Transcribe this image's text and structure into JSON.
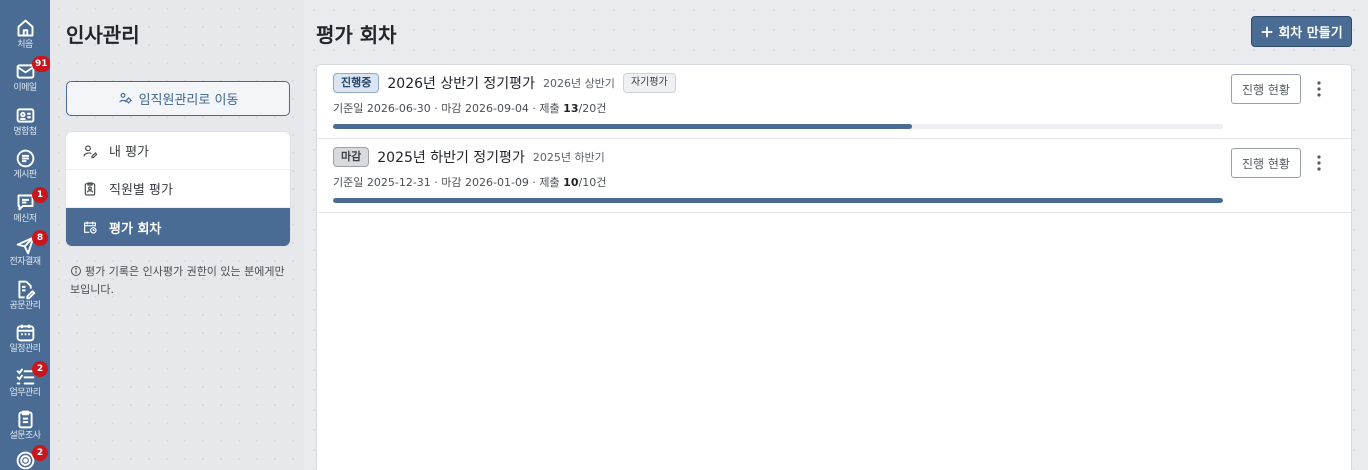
{
  "rail": {
    "items": [
      {
        "label": "처음",
        "icon": "home-icon",
        "badge": ""
      },
      {
        "label": "이메일",
        "icon": "mail-icon",
        "badge": "91"
      },
      {
        "label": "명함첩",
        "icon": "contact-card-icon",
        "badge": ""
      },
      {
        "label": "게시판",
        "icon": "board-icon",
        "badge": ""
      },
      {
        "label": "메신저",
        "icon": "messenger-icon",
        "badge": "1"
      },
      {
        "label": "전자결재",
        "icon": "approval-icon",
        "badge": "8"
      },
      {
        "label": "공문관리",
        "icon": "document-edit-icon",
        "badge": ""
      },
      {
        "label": "일정관리",
        "icon": "calendar-icon",
        "badge": ""
      },
      {
        "label": "업무관리",
        "icon": "task-list-icon",
        "badge": "2"
      },
      {
        "label": "설문조사",
        "icon": "survey-icon",
        "badge": ""
      },
      {
        "label": "",
        "icon": "target-icon",
        "badge": "2"
      }
    ]
  },
  "left": {
    "title": "인사관리",
    "move_button": "임직원관리로 이동",
    "menu": [
      {
        "label": "내 평가",
        "icon": "person-edit-icon",
        "active": false
      },
      {
        "label": "직원별 평가",
        "icon": "clipboard-person-icon",
        "active": false
      },
      {
        "label": "평가 회차",
        "icon": "calendar-clock-icon",
        "active": true
      }
    ],
    "note": "평가 기록은 인사평가 권한이 있는 분에게만 보입니다."
  },
  "main": {
    "title": "평가 회차",
    "create_button": "회차 만들기",
    "rounds": [
      {
        "status": "진행중",
        "status_kind": "ongoing",
        "name": "2026년 상반기 정기평가",
        "period": "2026년 상반기",
        "tag": "자기평가",
        "meta_prefix": "기준일 2026-06-30 · 마감 2026-09-04 · 제출 ",
        "submitted": "13",
        "meta_suffix": "/20건",
        "progress": 0.65,
        "status_button": "진행 현황"
      },
      {
        "status": "마감",
        "status_kind": "closed",
        "name": "2025년 하반기 정기평가",
        "period": "2025년 하반기",
        "tag": "",
        "meta_prefix": "기준일 2025-12-31 · 마감 2026-01-09 · 제출 ",
        "submitted": "10",
        "meta_suffix": "/10건",
        "progress": 1.0,
        "status_button": "진행 현황"
      }
    ]
  },
  "colors": {
    "accent": "#4a6c94",
    "badge": "#c8161d"
  }
}
